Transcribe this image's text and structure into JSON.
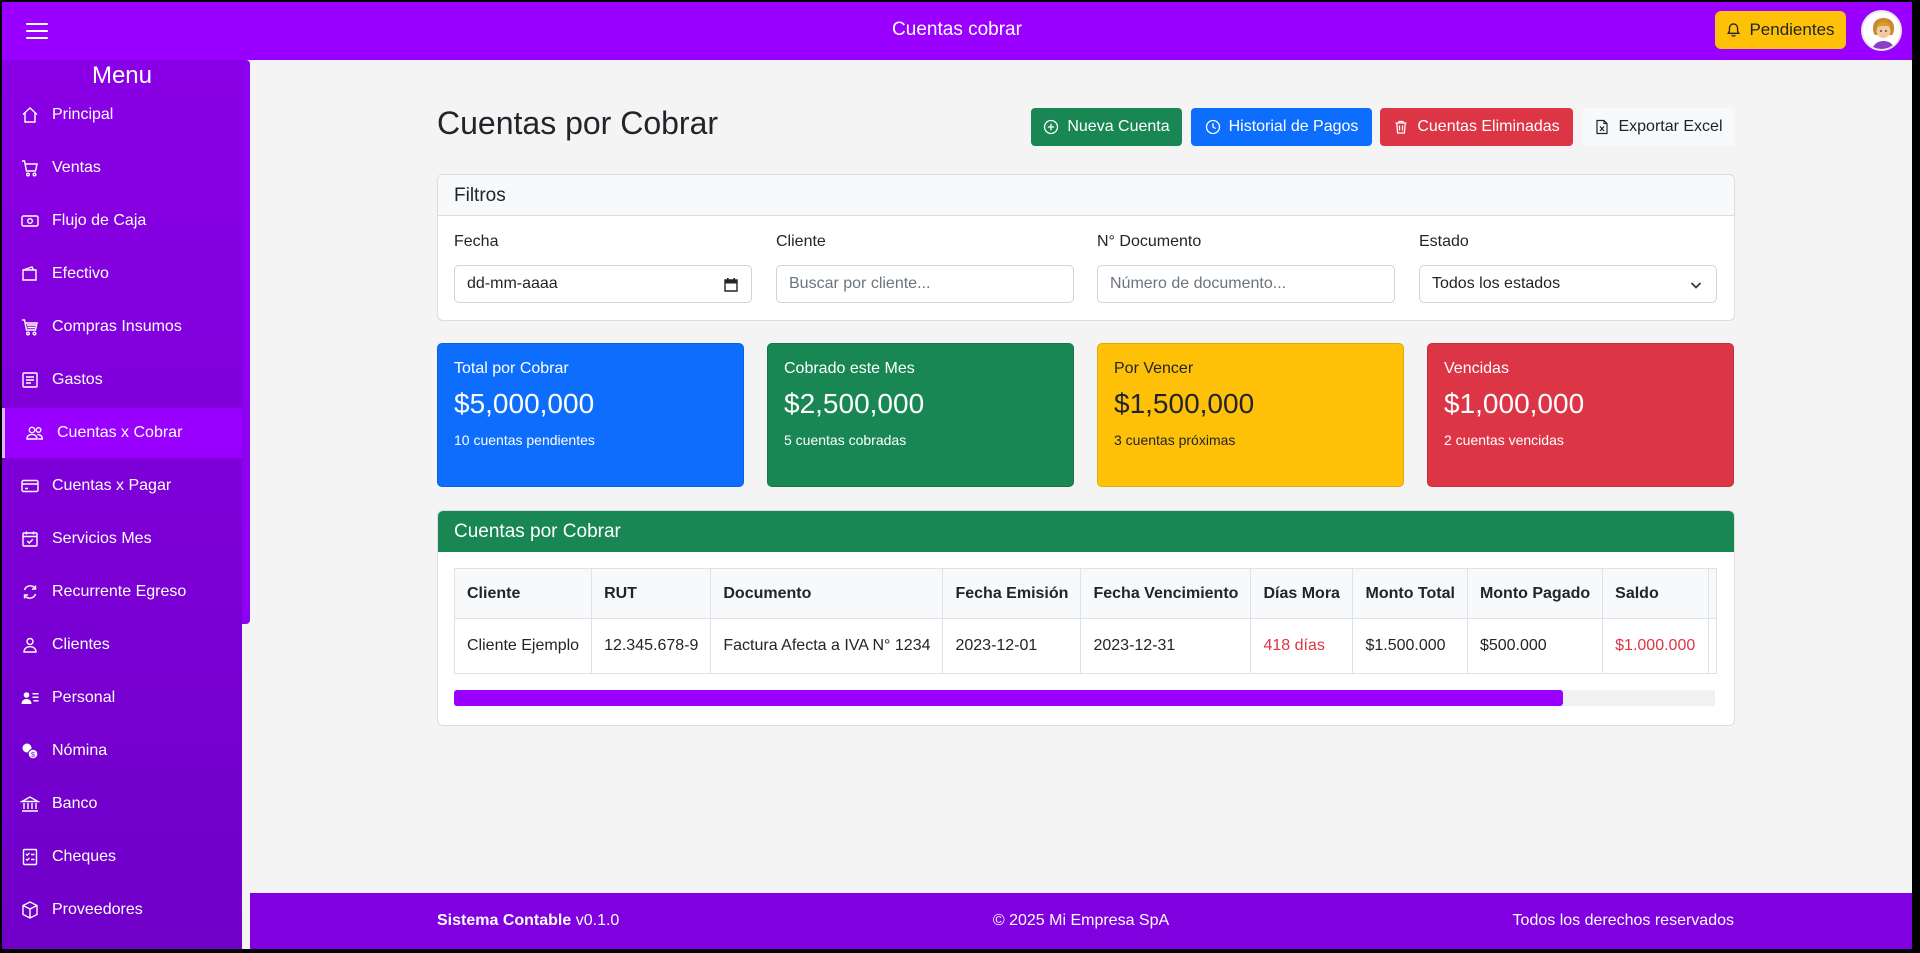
{
  "topbar": {
    "title": "Cuentas cobrar",
    "pending_label": "Pendientes"
  },
  "sidebar": {
    "title": "Menu",
    "items": [
      {
        "label": "Principal",
        "icon": "house-icon"
      },
      {
        "label": "Ventas",
        "icon": "cart-icon"
      },
      {
        "label": "Flujo de Caja",
        "icon": "cash-icon"
      },
      {
        "label": "Efectivo",
        "icon": "wallet-icon"
      },
      {
        "label": "Compras Insumos",
        "icon": "cart-fill-icon"
      },
      {
        "label": "Gastos",
        "icon": "receipt-icon"
      },
      {
        "label": "Cuentas x Cobrar",
        "icon": "people-icon",
        "active": true
      },
      {
        "label": "Cuentas x Pagar",
        "icon": "credit-card-icon"
      },
      {
        "label": "Servicios Mes",
        "icon": "calendar-check-icon"
      },
      {
        "label": "Recurrente Egreso",
        "icon": "arrow-repeat-icon"
      },
      {
        "label": "Clientes",
        "icon": "person-icon"
      },
      {
        "label": "Personal",
        "icon": "person-lines-icon"
      },
      {
        "label": "Nómina",
        "icon": "coins-icon"
      },
      {
        "label": "Banco",
        "icon": "bank-icon"
      },
      {
        "label": "Cheques",
        "icon": "check-list-icon"
      },
      {
        "label": "Proveedores",
        "icon": "box-icon"
      }
    ]
  },
  "main": {
    "title": "Cuentas por Cobrar",
    "actions": {
      "new": "Nueva Cuenta",
      "history": "Historial de Pagos",
      "deleted": "Cuentas Eliminadas",
      "export": "Exportar Excel"
    },
    "filters": {
      "title": "Filtros",
      "fecha_label": "Fecha",
      "fecha_value": "dd-mm-aaaa",
      "cliente_label": "Cliente",
      "cliente_placeholder": "Buscar por cliente...",
      "doc_label": "N° Documento",
      "doc_placeholder": "Número de documento...",
      "estado_label": "Estado",
      "estado_value": "Todos los estados"
    },
    "stats": [
      {
        "label": "Total por Cobrar",
        "value": "$5,000,000",
        "sub": "10 cuentas pendientes",
        "color": "#0d6efd"
      },
      {
        "label": "Cobrado este Mes",
        "value": "$2,500,000",
        "sub": "5 cuentas cobradas",
        "color": "#198754"
      },
      {
        "label": "Por Vencer",
        "value": "$1,500,000",
        "sub": "3 cuentas próximas",
        "color": "#ffc107"
      },
      {
        "label": "Vencidas",
        "value": "$1,000,000",
        "sub": "2 cuentas vencidas",
        "color": "#dc3545"
      }
    ],
    "table": {
      "title": "Cuentas por Cobrar",
      "headers": [
        "Cliente",
        "RUT",
        "Documento",
        "Fecha Emisión",
        "Fecha Vencimiento",
        "Días Mora",
        "Monto Total",
        "Monto Pagado",
        "Saldo"
      ],
      "rows": [
        [
          "Cliente Ejemplo",
          "12.345.678-9",
          "Factura Afecta a IVA N° 1234",
          "2023-12-01",
          "2023-12-31",
          "418 días",
          "$1.500.000",
          "$500.000",
          "$1.000.000"
        ]
      ]
    }
  },
  "footer": {
    "brand": "Sistema Contable",
    "version": "v0.1.0",
    "copyright": "© 2025 Mi Empresa SpA",
    "rights": "Todos los derechos reservados"
  }
}
